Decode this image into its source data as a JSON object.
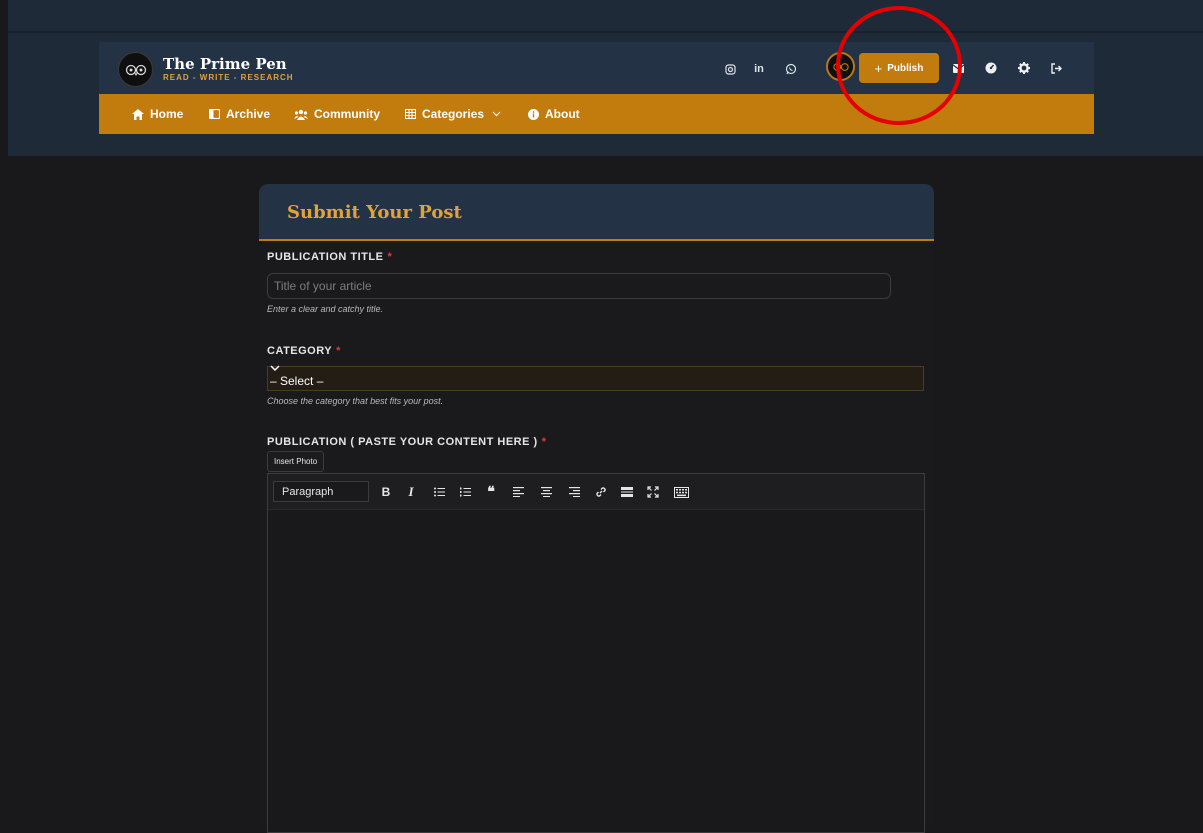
{
  "header": {
    "brand": "The Prime Pen",
    "tagline": "READ - WRITE - RESEARCH",
    "social_icons": [
      "instagram-icon",
      "linkedin-icon",
      "whatsapp-icon"
    ],
    "linkedin_text": "in",
    "publish_label": "Publish",
    "right_icons": [
      "envelope-icon",
      "dashboard-icon",
      "gear-icon",
      "logout-icon"
    ]
  },
  "nav": {
    "items": [
      {
        "label": "Home",
        "icon": "home-icon"
      },
      {
        "label": "Archive",
        "icon": "book-icon"
      },
      {
        "label": "Community",
        "icon": "users-icon"
      },
      {
        "label": "Categories",
        "icon": "grid-icon"
      },
      {
        "label": "About",
        "icon": "info-icon"
      }
    ]
  },
  "form": {
    "title": "Submit Your Post",
    "publication_title": {
      "label": "PUBLICATION TITLE",
      "required": "*",
      "placeholder": "Title of your article",
      "help": "Enter a clear and catchy title."
    },
    "category": {
      "label": "CATEGORY",
      "required": "*",
      "value": "– Select –",
      "help": "Choose the category that best fits your post."
    },
    "content": {
      "label": "PUBLICATION ( PASTE YOUR CONTENT HERE )",
      "required": "*",
      "insert_photo": "Insert Photo",
      "format_value": "Paragraph",
      "toolbar": [
        "bold",
        "italic",
        "bullet-list",
        "numbered-list",
        "quote",
        "align-left",
        "align-center",
        "align-right",
        "link",
        "horizontal-rule",
        "fullscreen",
        "keyboard"
      ]
    }
  },
  "annotation": {
    "color": "#e60000",
    "target": "publish-button"
  },
  "colors": {
    "accent": "#c17c0d",
    "header": "#233244",
    "background": "#19191b"
  }
}
